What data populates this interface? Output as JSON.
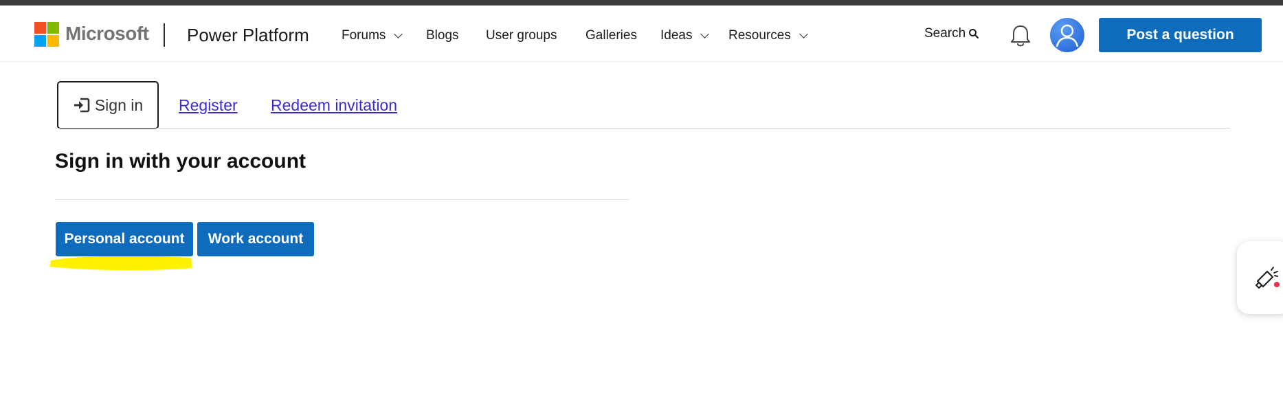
{
  "header": {
    "brand": "Microsoft",
    "product": "Power Platform",
    "nav": [
      {
        "label": "Forums",
        "has_dropdown": true
      },
      {
        "label": "Blogs",
        "has_dropdown": false
      },
      {
        "label": "User groups",
        "has_dropdown": false
      },
      {
        "label": "Galleries",
        "has_dropdown": false
      },
      {
        "label": "Ideas",
        "has_dropdown": true
      },
      {
        "label": "Resources",
        "has_dropdown": true
      }
    ],
    "search_label": "Search",
    "post_button": "Post a question"
  },
  "tabs": {
    "signin": "Sign in",
    "register": "Register",
    "redeem": "Redeem invitation"
  },
  "main": {
    "heading": "Sign in with your account",
    "personal_button": "Personal account",
    "work_button": "Work account"
  },
  "colors": {
    "accent": "#0f6cbd",
    "link": "#3b2bd6",
    "highlight": "#fff200",
    "ms_red": "#f25022",
    "ms_green": "#7fba00",
    "ms_blue": "#00a4ef",
    "ms_yellow": "#ffb900"
  },
  "icons": [
    "microsoft-logo",
    "chevron-down-icon",
    "search-icon",
    "bell-icon",
    "user-avatar-icon",
    "sign-in-icon",
    "feedback-megaphone-icon"
  ]
}
